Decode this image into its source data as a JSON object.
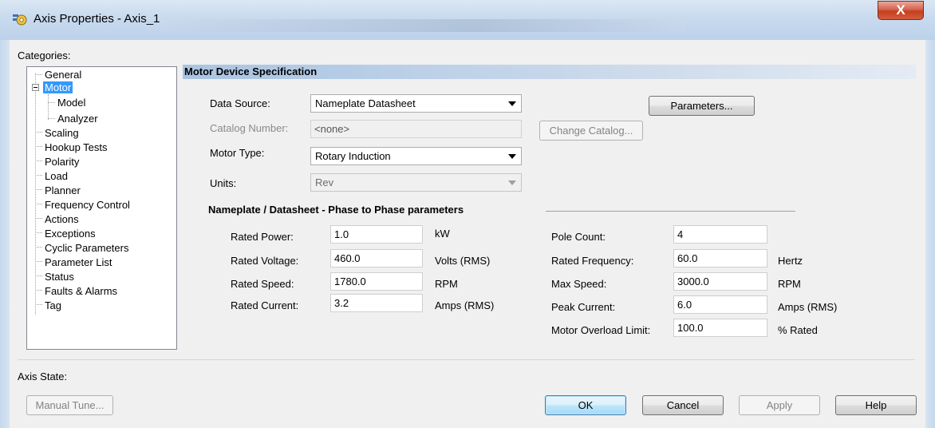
{
  "window": {
    "title": "Axis Properties - Axis_1",
    "close_glyph": "X"
  },
  "categories": {
    "label": "Categories:",
    "items": [
      "General",
      "Motor",
      "Model",
      "Analyzer",
      "Scaling",
      "Hookup Tests",
      "Polarity",
      "Load",
      "Planner",
      "Frequency Control",
      "Actions",
      "Exceptions",
      "Cyclic Parameters",
      "Parameter List",
      "Status",
      "Faults & Alarms",
      "Tag"
    ],
    "selected": "Motor"
  },
  "section": {
    "title": "Motor Device Specification"
  },
  "form": {
    "data_source_label": "Data Source:",
    "data_source_value": "Nameplate Datasheet",
    "catalog_label": "Catalog Number:",
    "catalog_value": "<none>",
    "change_catalog_label": "Change Catalog...",
    "parameters_label": "Parameters...",
    "motor_type_label": "Motor Type:",
    "motor_type_value": "Rotary Induction",
    "units_label": "Units:",
    "units_value": "Rev"
  },
  "nameplate": {
    "title": "Nameplate / Datasheet - Phase to Phase parameters",
    "left": [
      {
        "label": "Rated Power:",
        "value": "1.0",
        "unit": "kW"
      },
      {
        "label": "Rated Voltage:",
        "value": "460.0",
        "unit": "Volts (RMS)"
      },
      {
        "label": "Rated Speed:",
        "value": "1780.0",
        "unit": "RPM"
      },
      {
        "label": "Rated Current:",
        "value": "3.2",
        "unit": "Amps (RMS)"
      }
    ],
    "right": [
      {
        "label": "Pole Count:",
        "value": "4",
        "unit": ""
      },
      {
        "label": "Rated Frequency:",
        "value": "60.0",
        "unit": "Hertz"
      },
      {
        "label": "Max Speed:",
        "value": "3000.0",
        "unit": "RPM"
      },
      {
        "label": "Peak Current:",
        "value": "6.0",
        "unit": "Amps (RMS)"
      },
      {
        "label": "Motor Overload Limit:",
        "value": "100.0",
        "unit": "% Rated"
      }
    ]
  },
  "footer": {
    "axis_state_label": "Axis State:",
    "manual_tune_label": "Manual Tune...",
    "ok_label": "OK",
    "cancel_label": "Cancel",
    "apply_label": "Apply",
    "help_label": "Help"
  }
}
